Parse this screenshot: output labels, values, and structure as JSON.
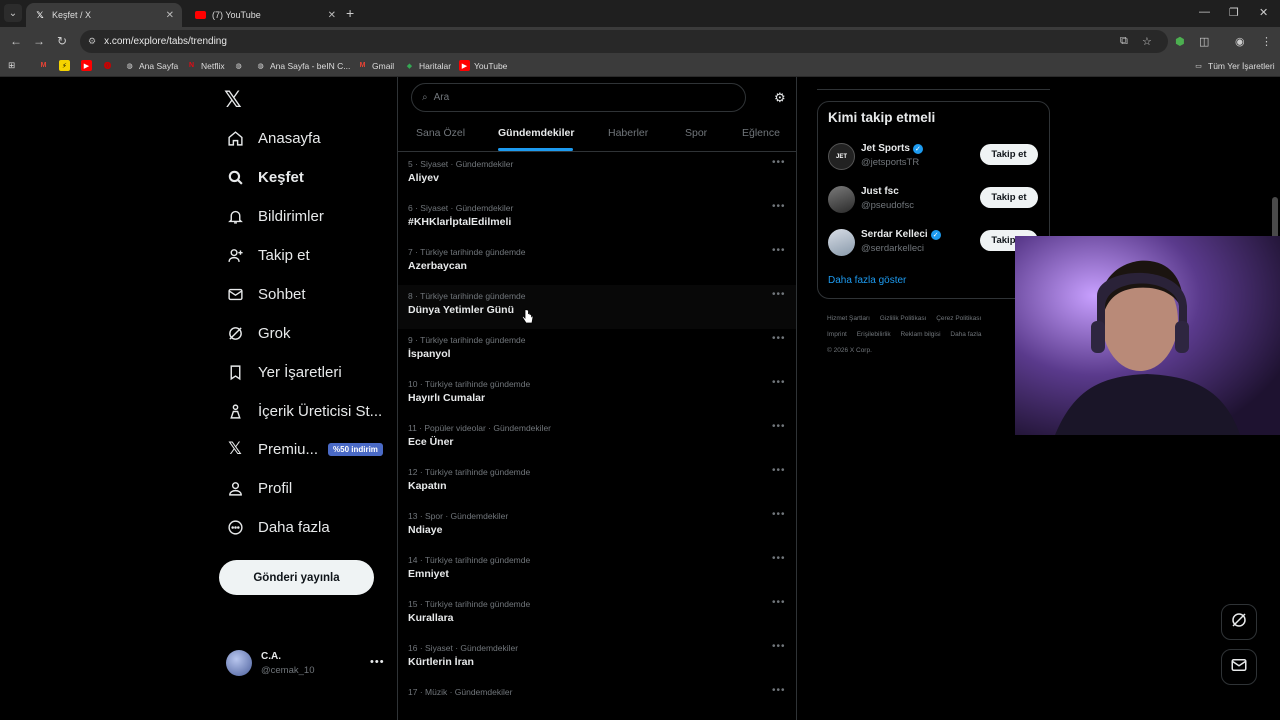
{
  "browser": {
    "tabs": [
      {
        "title": "Keşfet / X",
        "active": true
      },
      {
        "title": "(7) YouTube",
        "active": false
      }
    ],
    "url": "x.com/explore/tabs/trending",
    "bookmarks": [
      {
        "label": "Ana Sayfa"
      },
      {
        "label": "Netflix"
      },
      {
        "label": "Ana Sayfa - beIN C..."
      },
      {
        "label": "Gmail"
      },
      {
        "label": "Haritalar"
      },
      {
        "label": "YouTube"
      }
    ],
    "all_bookmarks": "Tüm Yer İşaretleri"
  },
  "nav": {
    "items": [
      {
        "label": "Anasayfa",
        "icon": "home-icon"
      },
      {
        "label": "Keşfet",
        "icon": "search-icon"
      },
      {
        "label": "Bildirimler",
        "icon": "bell-icon"
      },
      {
        "label": "Takip et",
        "icon": "follow-icon"
      },
      {
        "label": "Sohbet",
        "icon": "mail-icon"
      },
      {
        "label": "Grok",
        "icon": "grok-icon"
      },
      {
        "label": "Yer İşaretleri",
        "icon": "bookmark-icon"
      },
      {
        "label": "İçerik Üreticisi St...",
        "icon": "creator-icon"
      },
      {
        "label": "Premiu...",
        "icon": "x-icon",
        "badge": "%50 indirim"
      },
      {
        "label": "Profil",
        "icon": "profile-icon"
      },
      {
        "label": "Daha fazla",
        "icon": "more-icon"
      }
    ],
    "post_button": "Gönderi yayınla",
    "account": {
      "name": "C.A.",
      "handle": "@cemak_10"
    }
  },
  "explore": {
    "search_placeholder": "Ara",
    "tabs": [
      "Sana Özel",
      "Gündemdekiler",
      "Haberler",
      "Spor",
      "Eğlence"
    ],
    "active_tab": "Gündemdekiler",
    "trends": [
      {
        "meta": "5 · Siyaset · Gündemdekiler",
        "name": "Aliyev"
      },
      {
        "meta": "6 · Siyaset · Gündemdekiler",
        "name": "#KHKlarİptalEdilmeli"
      },
      {
        "meta": "7 · Türkiye tarihinde gündemde",
        "name": "Azerbaycan"
      },
      {
        "meta": "8 · Türkiye tarihinde gündemde",
        "name": "Dünya Yetimler Günü"
      },
      {
        "meta": "9 · Türkiye tarihinde gündemde",
        "name": "İspanyol"
      },
      {
        "meta": "10 · Türkiye tarihinde gündemde",
        "name": "Hayırlı Cumalar"
      },
      {
        "meta": "11 · Popüler videolar · Gündemdekiler",
        "name": "Ece Üner"
      },
      {
        "meta": "12 · Türkiye tarihinde gündemde",
        "name": "Kapatın"
      },
      {
        "meta": "13 · Spor · Gündemdekiler",
        "name": "Ndiaye"
      },
      {
        "meta": "14 · Türkiye tarihinde gündemde",
        "name": "Emniyet"
      },
      {
        "meta": "15 · Türkiye tarihinde gündemde",
        "name": "Kurallara"
      },
      {
        "meta": "16 · Siyaset · Gündemdekiler",
        "name": "Kürtlerin İran"
      },
      {
        "meta": "17 · Müzik · Gündemdekiler",
        "name": ""
      }
    ]
  },
  "who_to_follow": {
    "title": "Kimi takip etmeli",
    "users": [
      {
        "name": "Jet Sports",
        "handle": "@jetsportsTR",
        "verified": true,
        "button": "Takip et"
      },
      {
        "name": "Just fsc",
        "handle": "@pseudofsc",
        "verified": false,
        "button": "Takip et"
      },
      {
        "name": "Serdar Kelleci",
        "handle": "@serdarkelleci",
        "verified": true,
        "button": "Takip et"
      }
    ],
    "show_more": "Daha fazla göster"
  },
  "footer": {
    "links": [
      "Hizmet Şartları",
      "Gizlilik Politikası",
      "Çerez Politikası",
      "Imprint",
      "Erişilebilirlik",
      "Reklam bilgisi",
      "Daha fazla"
    ],
    "copyright": "© 2026 X Corp."
  },
  "colors": {
    "accent": "#1d9bf0",
    "background": "#000000",
    "badge": "#4a6ac6"
  }
}
